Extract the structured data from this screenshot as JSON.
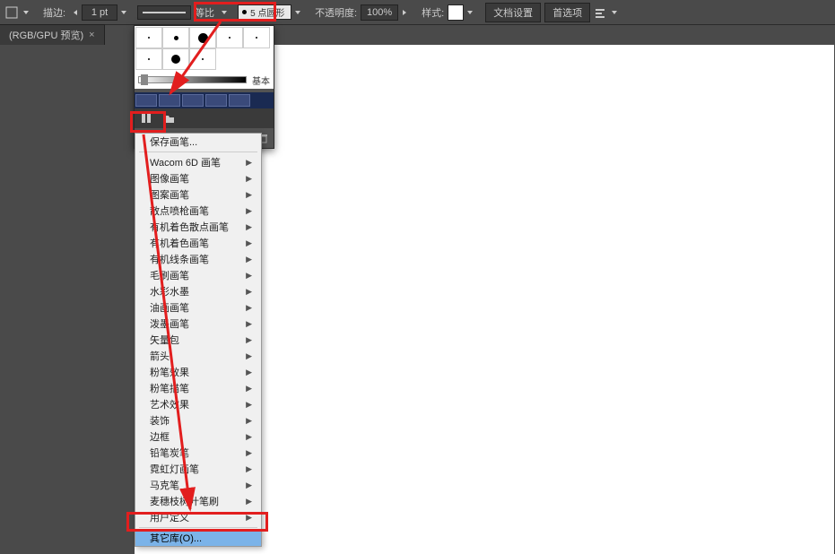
{
  "toolbar": {
    "stroke_label": "描边:",
    "stroke_value": "1 pt",
    "ratio_label": "等比",
    "brush_value": "5 点圆形",
    "opacity_label": "不透明度:",
    "opacity_value": "100%",
    "style_label": "样式:",
    "doc_setup": "文档设置",
    "preferences": "首选项"
  },
  "doc_tab": {
    "name": "(RGB/GPU 预览)",
    "close": "×"
  },
  "brush_panel": {
    "slider_label": "基本"
  },
  "menu": {
    "items": [
      {
        "label": "保存画笔...",
        "submenu": false
      },
      {
        "sep": true
      },
      {
        "label": "Wacom 6D 画笔",
        "submenu": true
      },
      {
        "label": "图像画笔",
        "submenu": true
      },
      {
        "label": "图案画笔",
        "submenu": true
      },
      {
        "label": "散点喷枪画笔",
        "submenu": true
      },
      {
        "label": "有机着色散点画笔",
        "submenu": true
      },
      {
        "label": "有机着色画笔",
        "submenu": true
      },
      {
        "label": "有机线条画笔",
        "submenu": true
      },
      {
        "label": "毛刷画笔",
        "submenu": true
      },
      {
        "label": "水彩水墨",
        "submenu": true
      },
      {
        "label": "油画画笔",
        "submenu": true
      },
      {
        "label": "泼墨画笔",
        "submenu": true
      },
      {
        "label": "矢量包",
        "submenu": true
      },
      {
        "label": "箭头",
        "submenu": true
      },
      {
        "label": "粉笔效果",
        "submenu": true
      },
      {
        "label": "粉笔描笔",
        "submenu": true
      },
      {
        "label": "艺术效果",
        "submenu": true
      },
      {
        "label": "装饰",
        "submenu": true
      },
      {
        "label": "边框",
        "submenu": true
      },
      {
        "label": "铅笔炭笔",
        "submenu": true
      },
      {
        "label": "霓虹灯画笔",
        "submenu": true
      },
      {
        "label": "马克笔",
        "submenu": true
      },
      {
        "label": "麦穗枝树叶笔刷",
        "submenu": true
      },
      {
        "label": "用户定义",
        "submenu": true
      },
      {
        "sep": true
      },
      {
        "label": "其它库(O)...",
        "submenu": false,
        "highlighted": true
      }
    ]
  }
}
